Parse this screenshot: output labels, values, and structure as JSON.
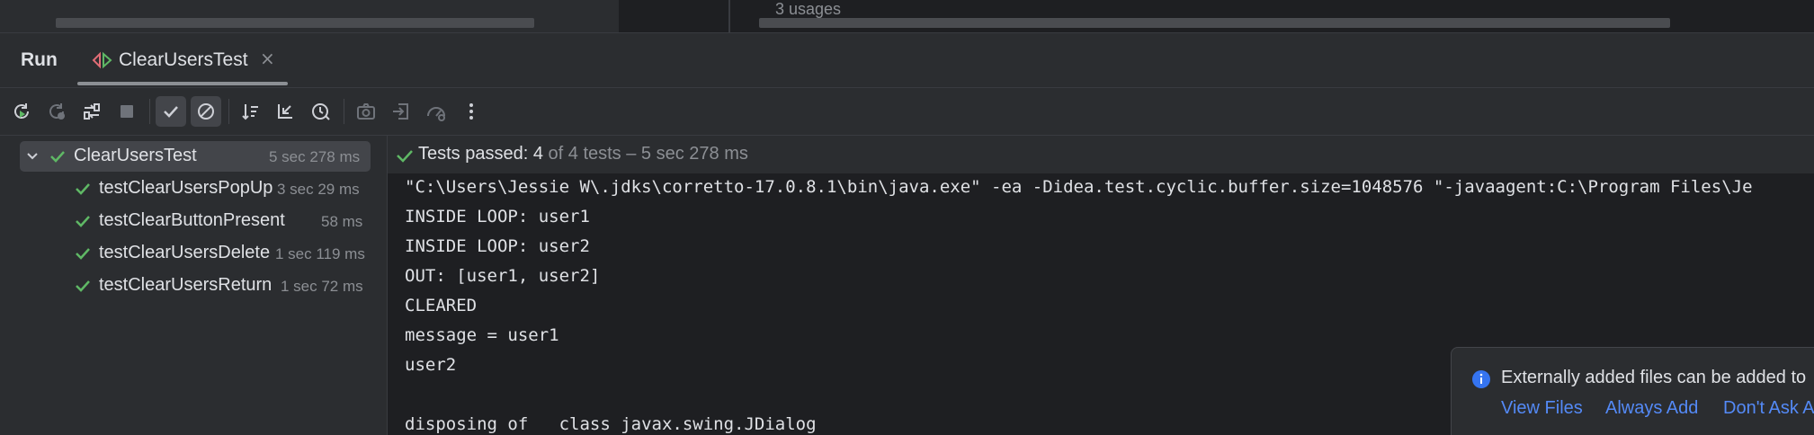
{
  "editor": {
    "usages_label": "3 usages"
  },
  "run_panel": {
    "title": "Run",
    "tab": {
      "label": "ClearUsersTest",
      "close_glyph": "×"
    }
  },
  "toolbar": {
    "icons": [
      "rerun-icon",
      "rerun-failed-icon",
      "toggle-auto-test-icon",
      "stop-icon",
      "show-passed-icon",
      "show-ignored-icon",
      "sort-icon",
      "collapse-icon",
      "history-icon",
      "camera-icon",
      "import-icon",
      "coverage-icon",
      "more-icon"
    ]
  },
  "tests": {
    "root": {
      "name": "ClearUsersTest",
      "time": "5 sec 278 ms"
    },
    "children": [
      {
        "name": "testClearUsersPopUp",
        "time": "3 sec 29 ms"
      },
      {
        "name": "testClearButtonPresent",
        "time": "58 ms"
      },
      {
        "name": "testClearUsersDelete",
        "time": "1 sec 119 ms"
      },
      {
        "name": "testClearUsersReturn",
        "time": "1 sec 72 ms"
      }
    ]
  },
  "status": {
    "passed": "Tests passed: 4",
    "detail": " of 4 tests – 5 sec 278 ms"
  },
  "console": {
    "lines": [
      "\"C:\\Users\\Jessie W\\.jdks\\corretto-17.0.8.1\\bin\\java.exe\" -ea -Didea.test.cyclic.buffer.size=1048576 \"-javaagent:C:\\Program Files\\Je",
      "INSIDE LOOP: user1",
      "INSIDE LOOP: user2",
      "OUT: [user1, user2]",
      "CLEARED",
      "message = user1",
      "user2",
      "",
      "disposing of   class javax.swing.JDialog"
    ]
  },
  "notification": {
    "text": "Externally added files can be added to",
    "links": [
      "View Files",
      "Always Add",
      "Don't Ask A"
    ]
  },
  "colors": {
    "success": "#5fb865",
    "link": "#548af7",
    "info": "#3574f0"
  }
}
